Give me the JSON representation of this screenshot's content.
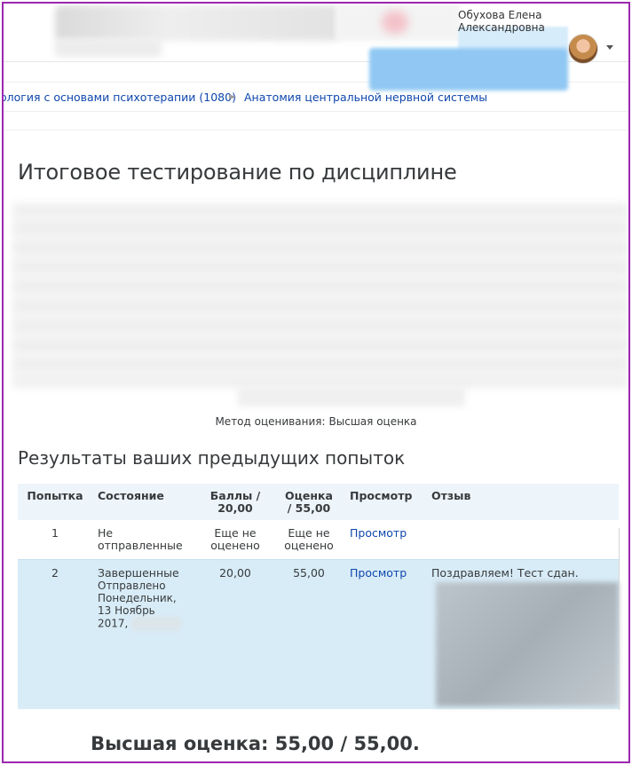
{
  "header": {
    "user_name": "Обухова Елена Александровна",
    "avatar_icon": "user-avatar"
  },
  "breadcrumb": {
    "course": "ология с основами психотерапии (1080)",
    "separator": "►",
    "section": "Анатомия центральной нервной системы"
  },
  "page": {
    "title": "Итоговое тестирование по дисциплине",
    "grading_method_label": "Метод оценивания:",
    "grading_method_value": "Высшая оценка",
    "results_heading": "Результаты ваших предыдущих попыток",
    "best_grade": "Высшая оценка: 55,00 / 55,00."
  },
  "table": {
    "headers": {
      "attempt": "Попытка",
      "state": "Состояние",
      "marks_line1": "Баллы /",
      "marks_line2": "20,00",
      "grade_line1": "Оценка",
      "grade_line2": "/ 55,00",
      "review": "Просмотр",
      "feedback": "Отзыв"
    },
    "rows": [
      {
        "attempt": "1",
        "state_line1": "Не",
        "state_line2": "отправленные",
        "marks_line1": "Еще не",
        "marks_line2": "оценено",
        "grade_line1": "Еще не",
        "grade_line2": "оценено",
        "review": "Просмотр",
        "feedback": ""
      },
      {
        "attempt": "2",
        "state": "Завершенные",
        "submitted_line1": "Отправлено",
        "submitted_line2": "Понедельник,",
        "submitted_line3": "13 Ноябрь",
        "submitted_line4": "2017,",
        "marks": "20,00",
        "grade": "55,00",
        "review": "Просмотр",
        "feedback": "Поздравляем! Тест сдан."
      }
    ]
  },
  "colors": {
    "link": "#0f47ad",
    "table_header_bg": "#edf4fa",
    "highlight_row_bg": "#d8ecf7",
    "frame": "#9c27b0"
  }
}
